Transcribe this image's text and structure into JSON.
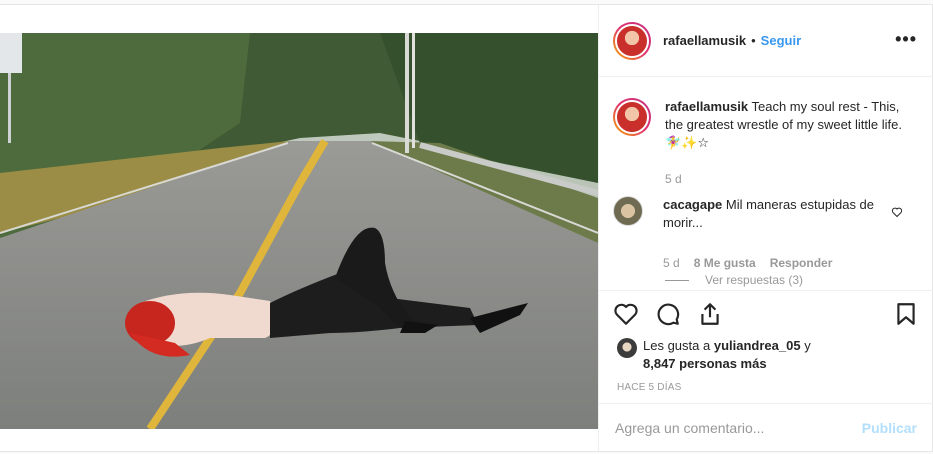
{
  "header": {
    "username": "rafaellamusik",
    "separator": "•",
    "follow_label": "Seguir",
    "more_icon": "ellipsis-icon"
  },
  "caption": {
    "username": "rafaellamusik",
    "text": "Teach my soul rest - This, the greatest wrestle of my sweet little life. 🧚‍♀️✨☆",
    "time": "5 d"
  },
  "comment": {
    "username": "cacagape",
    "text": "Mil maneras estupidas de morir...",
    "time": "5 d",
    "likes": "8 Me gusta",
    "reply_label": "Responder",
    "view_replies": "Ver respuestas (3)"
  },
  "actions": {
    "icons": [
      "heart-icon",
      "comment-icon",
      "share-icon",
      "bookmark-icon"
    ]
  },
  "likes": {
    "prefix": "Les gusta a",
    "user": "yuliandrea_05",
    "and": "y",
    "count": "8,847 personas más"
  },
  "timestamp": "HACE 5 DÍAS",
  "add_comment": {
    "placeholder": "Agrega un comentario...",
    "publish_label": "Publicar"
  },
  "colors": {
    "link": "#3897f0",
    "publish_disabled": "#b2dffc",
    "muted": "#999999"
  }
}
